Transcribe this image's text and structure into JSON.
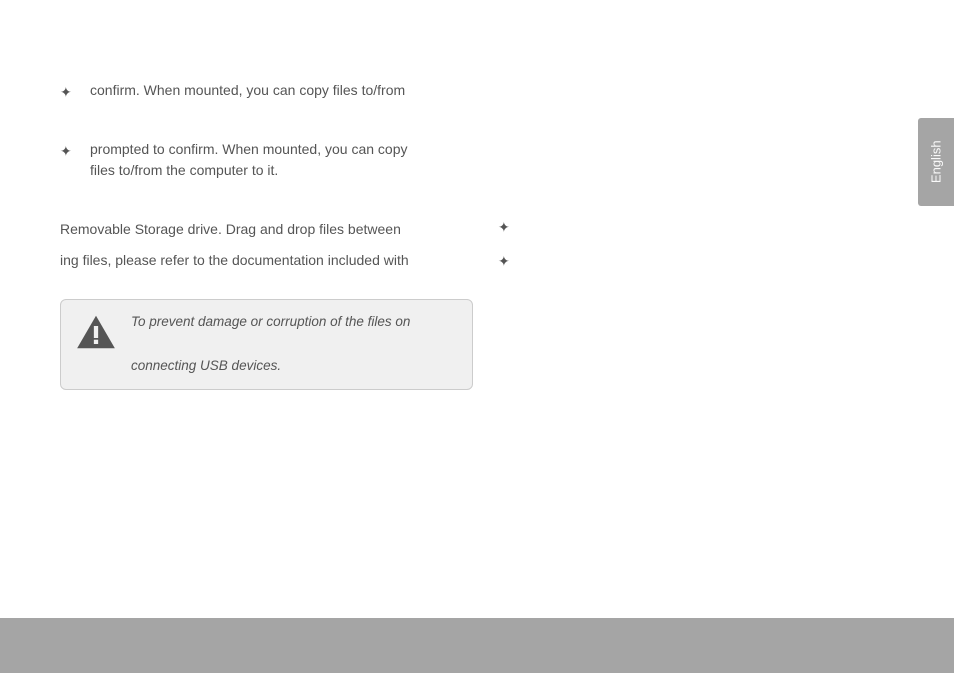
{
  "content": {
    "bullets": [
      {
        "text": "confirm. When mounted, you can copy files to/from"
      },
      {
        "text_line1": "prompted to confirm. When mounted, you can copy",
        "text_line2": "files to/from the computer to it."
      }
    ],
    "paragraph1": "Removable Storage drive. Drag and drop files between",
    "paragraph2": "ing files, please refer to the documentation included with",
    "infobox": {
      "line1": "To prevent damage or corruption of the files on",
      "line2": "connecting USB devices."
    }
  },
  "language_tab": "English"
}
